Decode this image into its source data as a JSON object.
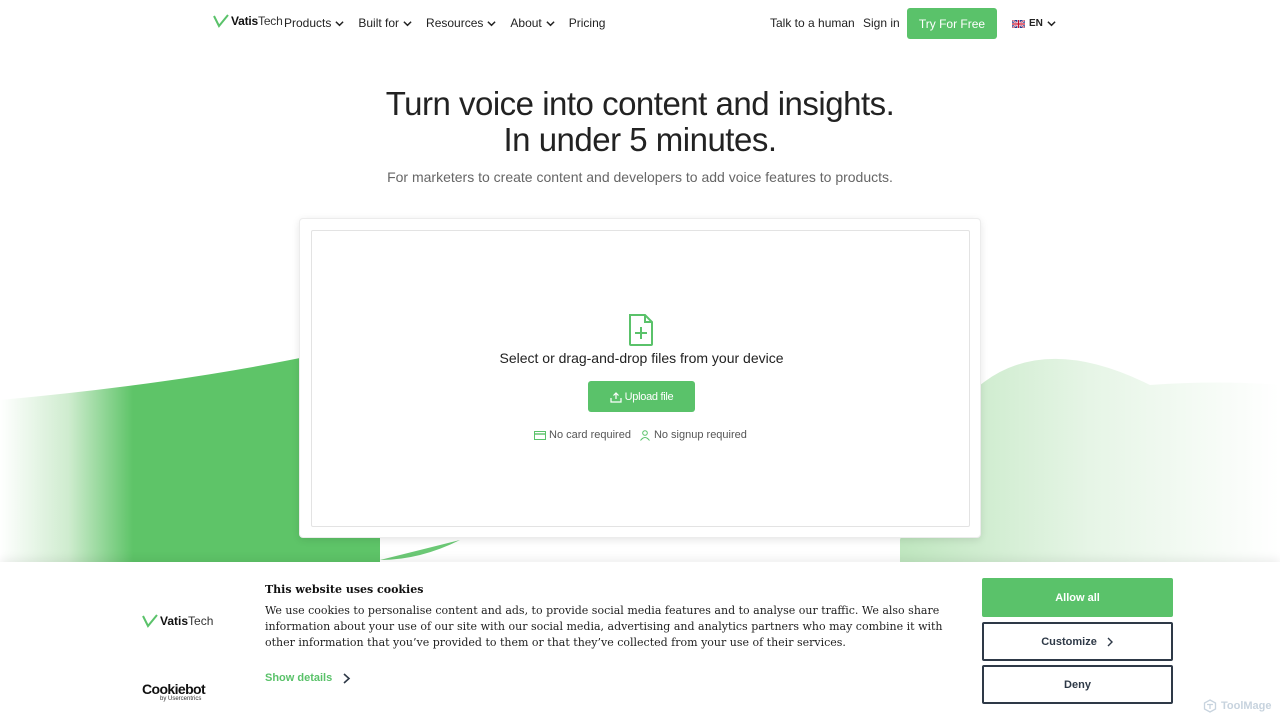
{
  "brand": {
    "name_bold": "Vatis",
    "name_light": "Tech",
    "accent": "#5ac26a",
    "dark": "#2e3947"
  },
  "nav": {
    "items": [
      {
        "label": "Products",
        "dropdown": true
      },
      {
        "label": "Built for",
        "dropdown": true
      },
      {
        "label": "Resources",
        "dropdown": true
      },
      {
        "label": "About",
        "dropdown": true
      },
      {
        "label": "Pricing",
        "dropdown": false
      }
    ],
    "talk": "Talk to a human",
    "signin": "Sign in",
    "cta": "Try For Free",
    "lang": "EN"
  },
  "hero": {
    "title_line1": "Turn voice into content and insights.",
    "title_line2": "In under 5 minutes.",
    "subtitle": "For marketers to create content and developers to add voice features to products."
  },
  "upload": {
    "prompt": "Select or drag-and-drop files from your device",
    "button": "Upload file",
    "no_card": "No card required",
    "no_signup": "No signup required"
  },
  "cookie": {
    "title": "This website uses cookies",
    "text": "We use cookies to personalise content and ads, to provide social media features and to analyse our traffic. We also share information about your use of our site with our social media, advertising and analytics partners who may combine it with other information that you’ve provided to them or that they’ve collected from your use of their services.",
    "show_details": "Show details",
    "allow_all": "Allow all",
    "customize": "Customize",
    "deny": "Deny",
    "cookiebot": "Cookiebot",
    "cookiebot_sub": "by Usercentrics"
  },
  "watermark": "ToolMage"
}
